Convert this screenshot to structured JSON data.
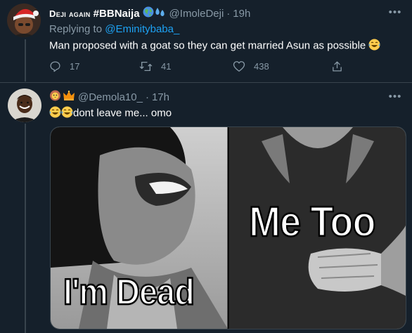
{
  "tweet1": {
    "display_name_smallcaps": "Deji again",
    "display_name_rest": " #BBNaija",
    "handle": "@ImoleDeji",
    "dot": "·",
    "time": "19h",
    "replying_prefix": "Replying to ",
    "replying_to": "@Eminitybaba_",
    "text": "Man proposed with a goat so they can get married Asun as possible ",
    "text_emoji": "tears-of-joy-emoji",
    "name_emojis": [
      "globe-emoji",
      "sweat-droplets-emoji"
    ],
    "more_label": "•••",
    "actions": {
      "reply_count": "17",
      "retweet_count": "41",
      "like_count": "438"
    }
  },
  "tweet2": {
    "name_emojis": [
      "lion-emoji",
      "crown-emoji"
    ],
    "handle": "@Demola10_",
    "dot": "·",
    "time": "17h",
    "text_emojis": [
      "tears-of-joy-emoji",
      "tears-of-joy-emoji"
    ],
    "text": "dont leave me... omo",
    "more_label": "•••",
    "media": {
      "left_caption": "I'm Dead",
      "right_caption": "Me Too"
    }
  },
  "colors": {
    "background": "#15202b",
    "text_primary": "#ffffff",
    "text_secondary": "#8899a6",
    "link": "#1da1f2",
    "divider": "#38444d"
  }
}
